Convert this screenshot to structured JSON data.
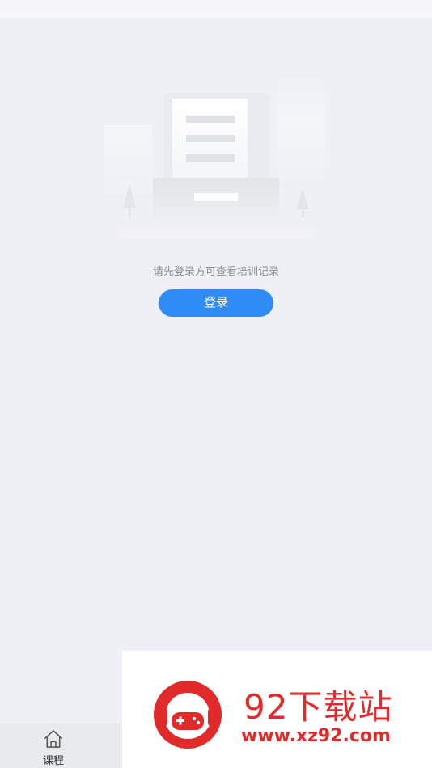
{
  "empty_state": {
    "illustration": "empty-records-illustration",
    "message": "请先登录方可查看培训记录",
    "login_button": "登录"
  },
  "tab_bar": {
    "items": [
      {
        "label": "课程",
        "icon": "home-icon"
      }
    ]
  },
  "watermark": {
    "title": "92下载站",
    "url": "www.xz92.com",
    "logo": "gamepad-logo",
    "color": "#e12b2b"
  },
  "colors": {
    "background": "#eef0f5",
    "accent": "#2f8cf6"
  }
}
